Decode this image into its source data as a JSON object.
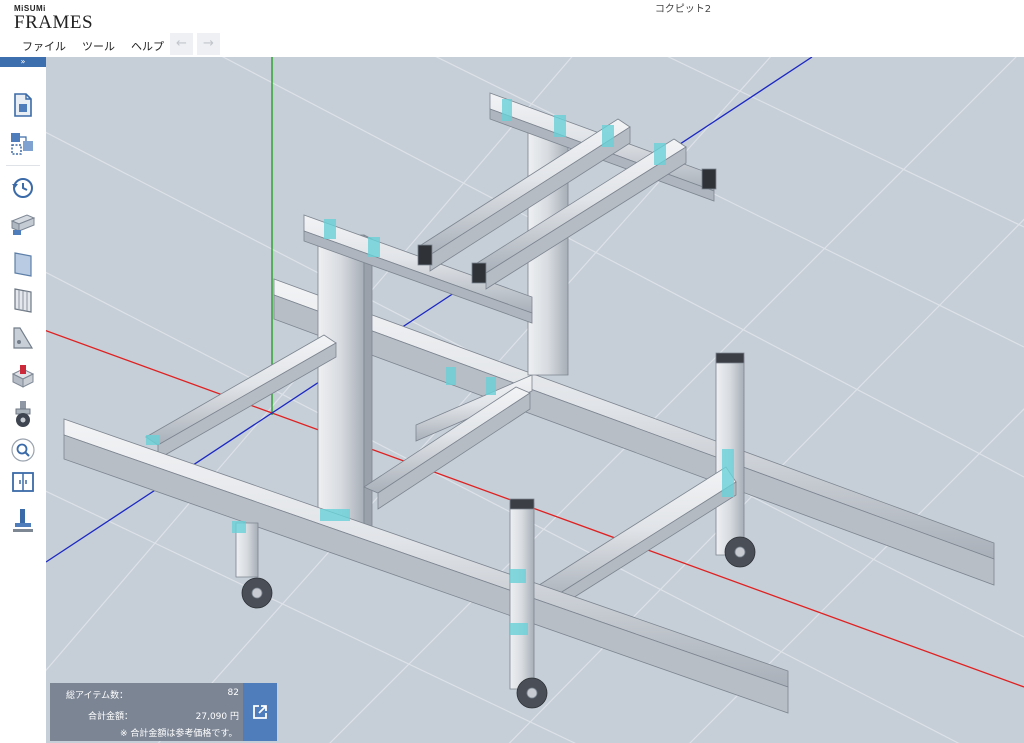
{
  "app": {
    "brand_small": "MiSUMi",
    "brand_big": "FRAMES",
    "document_title": "コクピット2"
  },
  "menu": {
    "file": "ファイル",
    "tools": "ツール",
    "help": "ヘルプ"
  },
  "toolbar": {
    "collapse_label": "»",
    "tools": [
      "new-file-icon",
      "assembly-icon",
      "history-icon",
      "frame-profile-icon",
      "panel-icon",
      "mesh-panel-icon",
      "bracket-icon",
      "accessory-icon",
      "caster-icon",
      "search-icon",
      "door-icon",
      "leveler-icon"
    ]
  },
  "summary": {
    "item_count_label": "総アイテム数：",
    "item_count": "82",
    "total_label": "合計金額：",
    "total_value": "27,090 円",
    "note": "※ 合計金額は参考価格です。"
  },
  "colors": {
    "viewport_bg": "#c6ced7",
    "axis_x": "#e02020",
    "axis_y": "#1a9e1a",
    "axis_z": "#1b28c4",
    "accent": "#4f7dbb"
  }
}
